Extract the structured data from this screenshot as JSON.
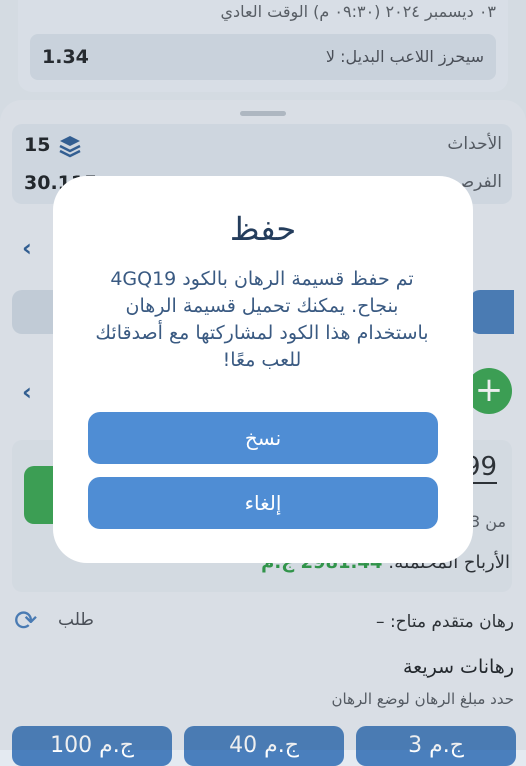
{
  "background": {
    "match_date": "٠٣ ديسمبر ٢٠٢٤ (٠٩:٣٠ م) الوقت العادي",
    "selection_label": "سيحرز اللاعب البديل: لا",
    "selection_odds": "1.34",
    "events_label": "الأحداث",
    "events_count": "15",
    "odds_label": "الفرص",
    "total_odds": "30.115",
    "left_chevron": "‹",
    "stake_value": "99",
    "min_text": "من 3",
    "potential_label": "الأرباح المحتملة:",
    "potential_amount": "2981.44 ج.م",
    "request_label": "طلب",
    "advance_bet_label": "رهان متقدم متاح: –",
    "quick_bets_title": "رهانات سريعة",
    "quick_bets_subtitle": "حدد مبلغ الرهان لوضع الرهان",
    "quick_buttons": [
      "100 ج.م",
      "40 ج.م",
      "3 ج.م"
    ],
    "colors": {
      "accent": "#4f8dd4",
      "green": "#3aa653"
    }
  },
  "dialog": {
    "title": "حفظ",
    "message": "تم حفظ قسيمة الرهان بالكود 4GQ19 بنجاح. يمكنك تحميل قسيمة الرهان باستخدام هذا الكود لمشاركتها مع أصدقائك للعب معًا!",
    "copy_label": "نسخ",
    "cancel_label": "إلغاء"
  }
}
